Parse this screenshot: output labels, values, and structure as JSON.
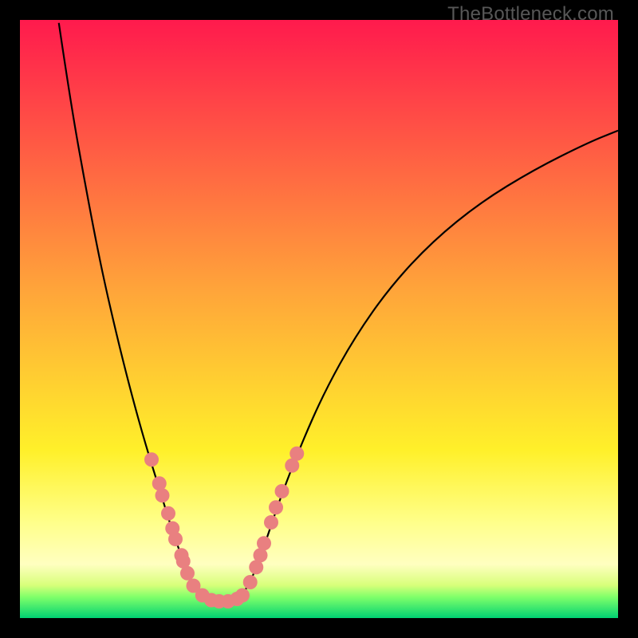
{
  "watermark": "TheBottleneck.com",
  "chart_data": {
    "type": "line",
    "title": "",
    "xlabel": "",
    "ylabel": "",
    "xlim": [
      0,
      100
    ],
    "ylim": [
      0,
      100
    ],
    "grid": false,
    "legend": false,
    "background_gradient": {
      "stops": [
        {
          "offset": 0.0,
          "color": "#ff1a4d"
        },
        {
          "offset": 0.45,
          "color": "#ffa43a"
        },
        {
          "offset": 0.72,
          "color": "#fff02a"
        },
        {
          "offset": 0.84,
          "color": "#ffff8a"
        },
        {
          "offset": 0.91,
          "color": "#ffffc0"
        },
        {
          "offset": 0.945,
          "color": "#d8ff7a"
        },
        {
          "offset": 0.965,
          "color": "#7fff6a"
        },
        {
          "offset": 1.0,
          "color": "#00d272"
        }
      ]
    },
    "green_band": {
      "y_start": 93.5,
      "y_end": 100
    },
    "curve_left": {
      "description": "left descending arm of V-curve",
      "points": [
        {
          "x": 6.5,
          "y": 0.5
        },
        {
          "x": 8.5,
          "y": 14
        },
        {
          "x": 11.0,
          "y": 28
        },
        {
          "x": 13.5,
          "y": 41
        },
        {
          "x": 16.0,
          "y": 52
        },
        {
          "x": 18.5,
          "y": 62
        },
        {
          "x": 21.0,
          "y": 71
        },
        {
          "x": 23.5,
          "y": 79
        },
        {
          "x": 25.5,
          "y": 85.5
        },
        {
          "x": 27.5,
          "y": 91
        },
        {
          "x": 29.0,
          "y": 94.5
        },
        {
          "x": 30.5,
          "y": 96.5
        }
      ]
    },
    "curve_bottom": {
      "description": "flat valley near y≈97",
      "points": [
        {
          "x": 30.5,
          "y": 96.5
        },
        {
          "x": 32.5,
          "y": 97.3
        },
        {
          "x": 35.0,
          "y": 97.3
        },
        {
          "x": 37.0,
          "y": 96.5
        }
      ]
    },
    "curve_right": {
      "description": "right ascending arm of V-curve",
      "points": [
        {
          "x": 37.0,
          "y": 96.5
        },
        {
          "x": 39.0,
          "y": 93
        },
        {
          "x": 41.0,
          "y": 87.5
        },
        {
          "x": 43.5,
          "y": 80
        },
        {
          "x": 47.0,
          "y": 71
        },
        {
          "x": 51.0,
          "y": 62
        },
        {
          "x": 56.0,
          "y": 53
        },
        {
          "x": 62.0,
          "y": 44.5
        },
        {
          "x": 69.0,
          "y": 37
        },
        {
          "x": 77.0,
          "y": 30.5
        },
        {
          "x": 86.0,
          "y": 25
        },
        {
          "x": 95.0,
          "y": 20.5
        },
        {
          "x": 100.0,
          "y": 18.5
        }
      ]
    },
    "marker_clusters": {
      "description": "salmon bead-like markers along lower portion of curve",
      "left_arm": [
        {
          "x": 22.0,
          "y": 73.5
        },
        {
          "x": 23.3,
          "y": 77.5
        },
        {
          "x": 23.8,
          "y": 79.5
        },
        {
          "x": 24.8,
          "y": 82.5
        },
        {
          "x": 25.5,
          "y": 85.0
        },
        {
          "x": 26.0,
          "y": 86.8
        },
        {
          "x": 27.0,
          "y": 89.5
        },
        {
          "x": 27.3,
          "y": 90.5
        },
        {
          "x": 28.0,
          "y": 92.5
        },
        {
          "x": 29.0,
          "y": 94.6
        }
      ],
      "bottom": [
        {
          "x": 30.5,
          "y": 96.2
        },
        {
          "x": 32.0,
          "y": 97.0
        },
        {
          "x": 33.3,
          "y": 97.2
        },
        {
          "x": 34.8,
          "y": 97.2
        },
        {
          "x": 36.3,
          "y": 96.8
        },
        {
          "x": 37.2,
          "y": 96.2
        }
      ],
      "right_arm": [
        {
          "x": 38.5,
          "y": 94.0
        },
        {
          "x": 39.5,
          "y": 91.5
        },
        {
          "x": 40.2,
          "y": 89.5
        },
        {
          "x": 40.8,
          "y": 87.5
        },
        {
          "x": 42.0,
          "y": 84.0
        },
        {
          "x": 42.8,
          "y": 81.5
        },
        {
          "x": 43.8,
          "y": 78.8
        },
        {
          "x": 45.5,
          "y": 74.5
        },
        {
          "x": 46.3,
          "y": 72.5
        }
      ]
    },
    "marker_style": {
      "fill": "#e98080",
      "radius_px": 9
    }
  }
}
